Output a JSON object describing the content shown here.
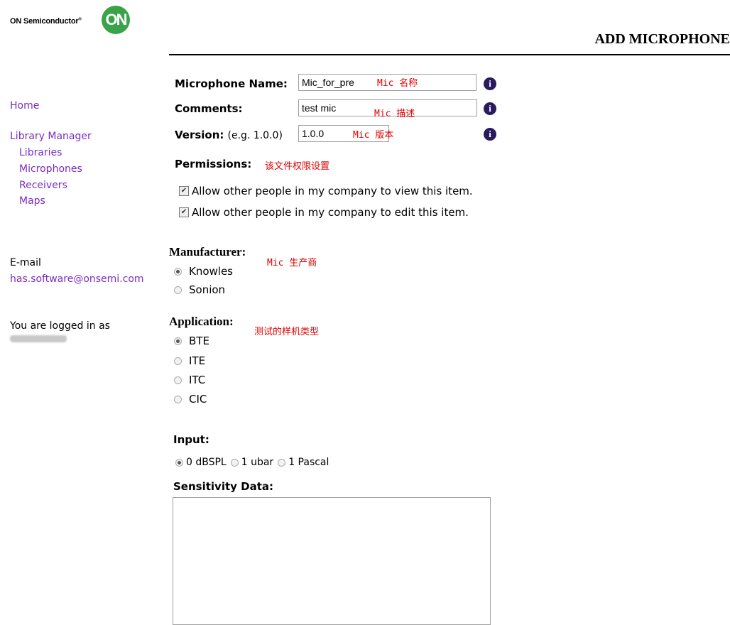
{
  "header": {
    "company_text": "ON Semiconductor",
    "registered_mark": "®",
    "logo_text": "ON",
    "page_title": "ADD MICROPHONE"
  },
  "sidebar": {
    "home": "Home",
    "library_manager": "Library Manager",
    "items": [
      {
        "label": "Libraries"
      },
      {
        "label": "Microphones"
      },
      {
        "label": "Receivers"
      },
      {
        "label": "Maps"
      }
    ],
    "email_label": "E-mail",
    "email": "has.software@onsemi.com",
    "logged_in": "You are logged in as"
  },
  "form": {
    "name": {
      "label": "Microphone Name:",
      "value": "Mic_for_pre",
      "note": "Mic 名称"
    },
    "comments": {
      "label": "Comments:",
      "value": "test mic",
      "note": "Mic 描述"
    },
    "version": {
      "label": "Version:",
      "hint": "(e.g. 1.0.0)",
      "value": "1.0.0",
      "note": "Mic 版本"
    },
    "info_glyph": "i",
    "permissions": {
      "label": "Permissions:",
      "note": "该文件权限设置",
      "view": "Allow other people in my company to view this item.",
      "edit": "Allow other people in my company to edit this item.",
      "check_glyph": "✔"
    },
    "manufacturer": {
      "label": "Manufacturer:",
      "note": "Mic 生产商",
      "options": [
        "Knowles",
        "Sonion"
      ],
      "selected": "Knowles"
    },
    "application": {
      "label": "Application:",
      "note": "测试的样机类型",
      "options": [
        "BTE",
        "ITE",
        "ITC",
        "CIC"
      ],
      "selected": "BTE"
    },
    "input": {
      "label": "Input:",
      "options": [
        "0 dBSPL",
        "1 ubar",
        "1 Pascal"
      ],
      "selected": "0 dBSPL"
    },
    "sensitivity": {
      "label": "Sensitivity Data:",
      "value": ""
    }
  },
  "colors": {
    "link": "#7b2cbf",
    "note": "#e00000",
    "logo": "#3aa34a",
    "info": "#2a1a5e"
  }
}
